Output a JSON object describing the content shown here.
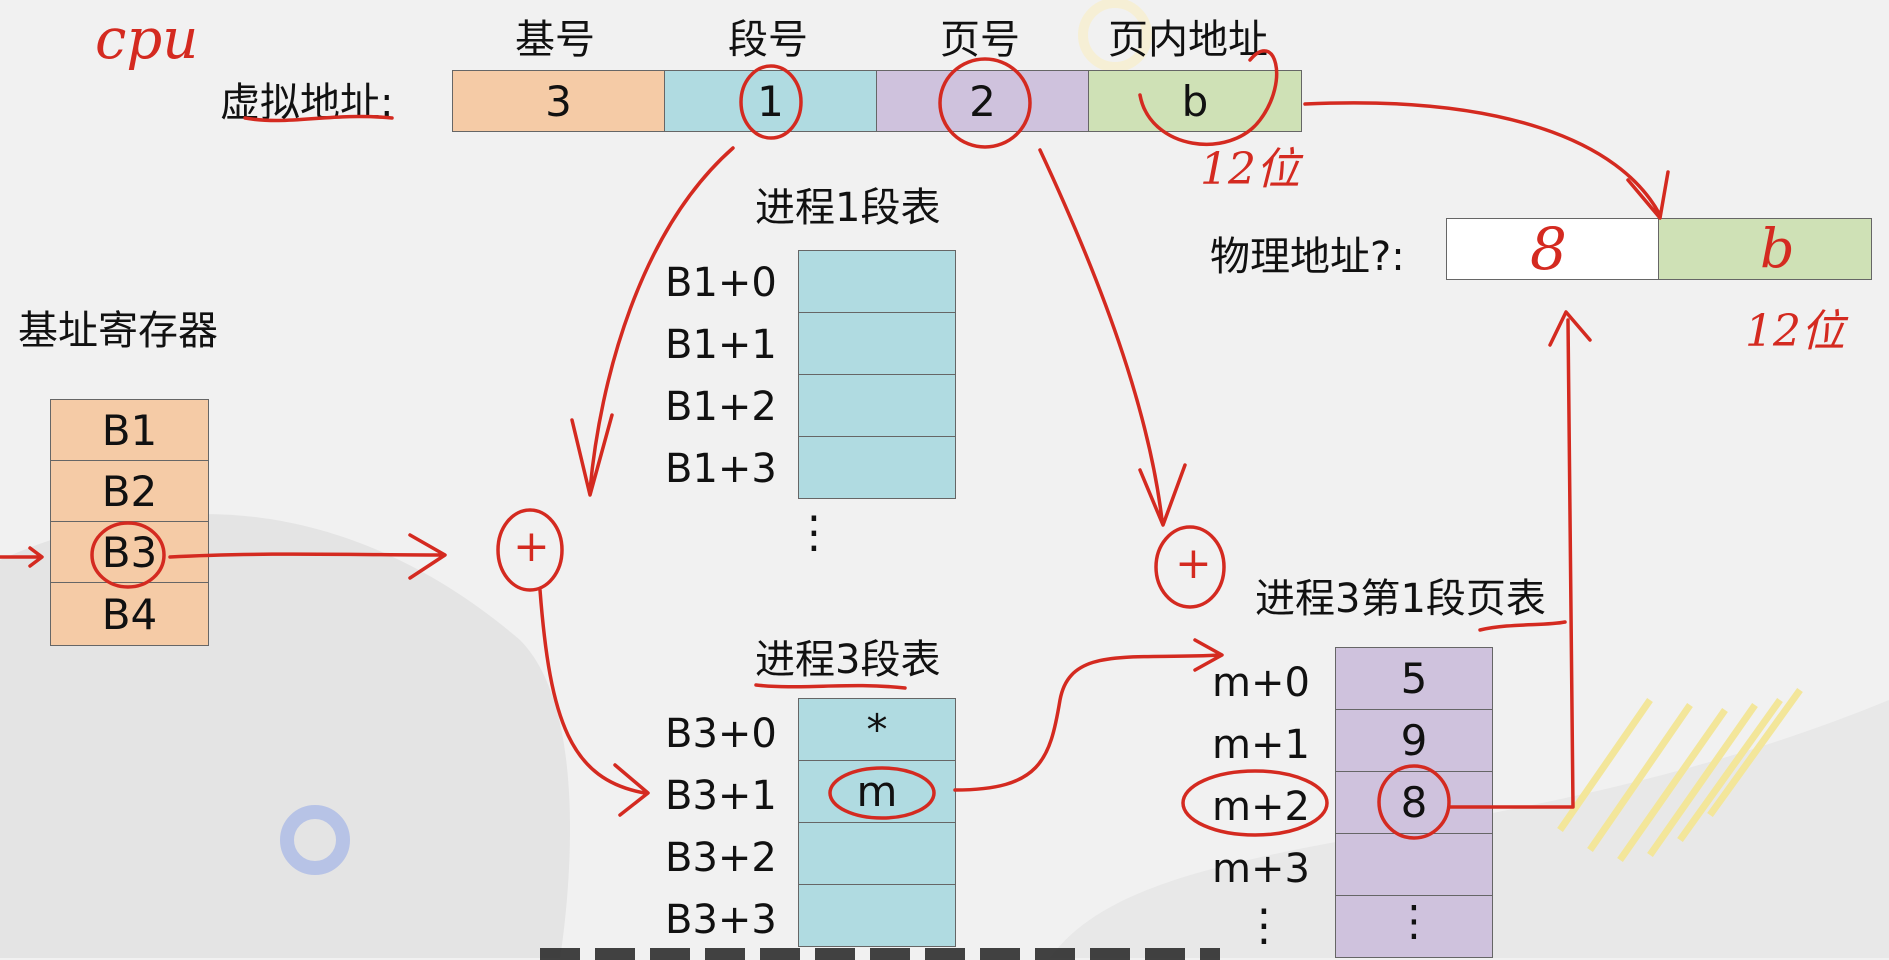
{
  "annotations": {
    "cpu": "cpu",
    "bits_virtual": "12位",
    "bits_physical": "12位",
    "physical_frame": "8",
    "physical_offset": "b",
    "plus_left": "+",
    "plus_right": "+"
  },
  "virtual_address": {
    "label": "虚拟地址:",
    "fields": [
      {
        "header": "基号",
        "value": "3"
      },
      {
        "header": "段号",
        "value": "1"
      },
      {
        "header": "页号",
        "value": "2"
      },
      {
        "header": "页内地址",
        "value": "b"
      }
    ]
  },
  "physical_address": {
    "label": "物理地址?:"
  },
  "base_registers": {
    "title": "基址寄存器",
    "items": [
      "B1",
      "B2",
      "B3",
      "B4"
    ]
  },
  "segment_table_1": {
    "title": "进程1段表",
    "rows": [
      {
        "label": "B1+0",
        "value": ""
      },
      {
        "label": "B1+1",
        "value": ""
      },
      {
        "label": "B1+2",
        "value": ""
      },
      {
        "label": "B1+3",
        "value": ""
      }
    ],
    "more": "⋮"
  },
  "segment_table_3": {
    "title": "进程3段表",
    "rows": [
      {
        "label": "B3+0",
        "value": "*"
      },
      {
        "label": "B3+1",
        "value": "m"
      },
      {
        "label": "B3+2",
        "value": ""
      },
      {
        "label": "B3+3",
        "value": ""
      }
    ]
  },
  "page_table": {
    "title": "进程3第1段页表",
    "rows": [
      {
        "label": "m+0",
        "value": "5"
      },
      {
        "label": "m+1",
        "value": "9"
      },
      {
        "label": "m+2",
        "value": "8"
      },
      {
        "label": "m+3",
        "value": ""
      },
      {
        "label": "⋮",
        "value": "⋮"
      }
    ]
  },
  "colors": {
    "base_register": "#f5cba6",
    "segment": "#b0dbe1",
    "page": "#cfc2dd",
    "offset": "#cfe1b6",
    "ink": "#d42a20"
  }
}
